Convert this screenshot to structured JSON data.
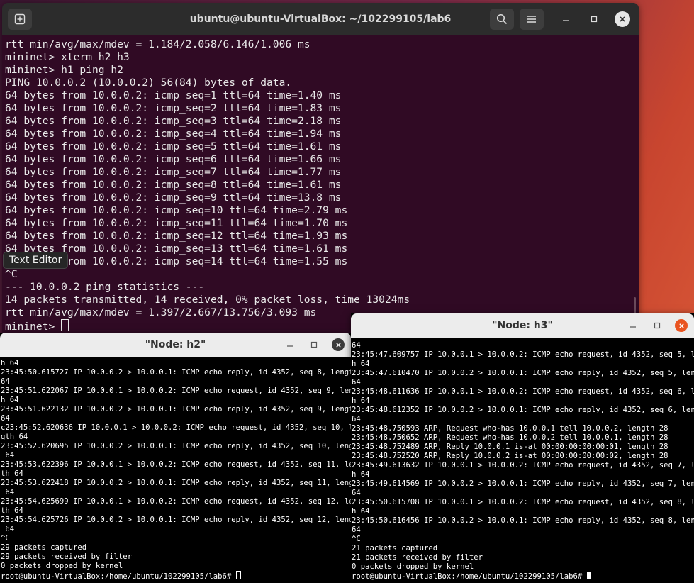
{
  "main_window": {
    "title": "ubuntu@ubuntu-VirtualBox: ~/102299105/lab6",
    "lines": [
      "rtt min/avg/max/mdev = 1.184/2.058/6.146/1.006 ms",
      "mininet> xterm h2 h3",
      "mininet> h1 ping h2",
      "PING 10.0.0.2 (10.0.0.2) 56(84) bytes of data.",
      "64 bytes from 10.0.0.2: icmp_seq=1 ttl=64 time=1.40 ms",
      "64 bytes from 10.0.0.2: icmp_seq=2 ttl=64 time=1.83 ms",
      "64 bytes from 10.0.0.2: icmp_seq=3 ttl=64 time=2.18 ms",
      "64 bytes from 10.0.0.2: icmp_seq=4 ttl=64 time=1.94 ms",
      "64 bytes from 10.0.0.2: icmp_seq=5 ttl=64 time=1.61 ms",
      "64 bytes from 10.0.0.2: icmp_seq=6 ttl=64 time=1.66 ms",
      "64 bytes from 10.0.0.2: icmp_seq=7 ttl=64 time=1.77 ms",
      "64 bytes from 10.0.0.2: icmp_seq=8 ttl=64 time=1.61 ms",
      "64 bytes from 10.0.0.2: icmp_seq=9 ttl=64 time=13.8 ms",
      "64 bytes from 10.0.0.2: icmp_seq=10 ttl=64 time=2.79 ms",
      "64 bytes from 10.0.0.2: icmp_seq=11 ttl=64 time=1.70 ms",
      "64 bytes from 10.0.0.2: icmp_seq=12 ttl=64 time=1.93 ms",
      "64 bytes from 10.0.0.2: icmp_seq=13 ttl=64 time=1.61 ms",
      "64 bytes from 10.0.0.2: icmp_seq=14 ttl=64 time=1.55 ms",
      "^C",
      "--- 10.0.0.2 ping statistics ---",
      "14 packets transmitted, 14 received, 0% packet loss, time 13024ms",
      "rtt min/avg/max/mdev = 1.397/2.667/13.756/3.093 ms"
    ],
    "prompt": "mininet> ",
    "tooltip": "Text Editor",
    "icons": {
      "new_tab": "new-tab-icon",
      "search": "search-icon",
      "menu": "hamburger-menu-icon",
      "minimize": "minimize-icon",
      "maximize": "maximize-icon",
      "close": "close-icon"
    }
  },
  "h2_window": {
    "title": "\"Node: h2\"",
    "lines": [
      "h 64",
      "23:45:50.615727 IP 10.0.0.2 > 10.0.0.1: ICMP echo reply, id 4352, seq 8, length",
      "64",
      "23:45:51.622067 IP 10.0.0.1 > 10.0.0.2: ICMP echo request, id 4352, seq 9, lengt",
      "h 64",
      "23:45:51.622132 IP 10.0.0.2 > 10.0.0.1: ICMP echo reply, id 4352, seq 9, length",
      "64",
      "c23:45:52.620636 IP 10.0.0.1 > 10.0.0.2: ICMP echo request, id 4352, seq 10, len",
      "gth 64",
      "23:45:52.620695 IP 10.0.0.2 > 10.0.0.1: ICMP echo reply, id 4352, seq 10, length",
      " 64",
      "23:45:53.622396 IP 10.0.0.1 > 10.0.0.2: ICMP echo request, id 4352, seq 11, leng",
      "th 64",
      "23:45:53.622418 IP 10.0.0.2 > 10.0.0.1: ICMP echo reply, id 4352, seq 11, length",
      " 64",
      "23:45:54.625699 IP 10.0.0.1 > 10.0.0.2: ICMP echo request, id 4352, seq 12, leng",
      "th 64",
      "23:45:54.625726 IP 10.0.0.2 > 10.0.0.1: ICMP echo reply, id 4352, seq 12, length",
      " 64",
      "^C",
      "29 packets captured",
      "29 packets received by filter",
      "0 packets dropped by kernel"
    ],
    "prompt": "root@ubuntu-VirtualBox:/home/ubuntu/102299105/lab6# "
  },
  "h3_window": {
    "title": "\"Node: h3\"",
    "lines": [
      "64",
      "23:45:47.609757 IP 10.0.0.1 > 10.0.0.2: ICMP echo request, id 4352, seq 5, lengt",
      "h 64",
      "23:45:47.610470 IP 10.0.0.2 > 10.0.0.1: ICMP echo reply, id 4352, seq 5, length",
      "64",
      "23:45:48.611636 IP 10.0.0.1 > 10.0.0.2: ICMP echo request, id 4352, seq 6, lengt",
      "h 64",
      "23:45:48.612352 IP 10.0.0.2 > 10.0.0.1: ICMP echo reply, id 4352, seq 6, length",
      "64",
      "23:45:48.750593 ARP, Request who-has 10.0.0.1 tell 10.0.0.2, length 28",
      "23:45:48.750652 ARP, Request who-has 10.0.0.2 tell 10.0.0.1, length 28",
      "23:45:48.752489 ARP, Reply 10.0.0.1 is-at 00:00:00:00:00:01, length 28",
      "23:45:48.752520 ARP, Reply 10.0.0.2 is-at 00:00:00:00:00:02, length 28",
      "23:45:49.613632 IP 10.0.0.1 > 10.0.0.2: ICMP echo request, id 4352, seq 7, lengt",
      "h 64",
      "23:45:49.614569 IP 10.0.0.2 > 10.0.0.1: ICMP echo reply, id 4352, seq 7, length",
      "64",
      "23:45:50.615708 IP 10.0.0.1 > 10.0.0.2: ICMP echo request, id 4352, seq 8, lengt",
      "h 64",
      "23:45:50.616456 IP 10.0.0.2 > 10.0.0.1: ICMP echo reply, id 4352, seq 8, length",
      "64",
      "^C",
      "21 packets captured",
      "21 packets received by filter",
      "0 packets dropped by kernel"
    ],
    "prompt": "root@ubuntu-VirtualBox:/home/ubuntu/102299105/lab6# "
  },
  "colors": {
    "terminal_bg": "#300a24",
    "xterm_bg": "#000000",
    "close_red": "#e95420"
  }
}
